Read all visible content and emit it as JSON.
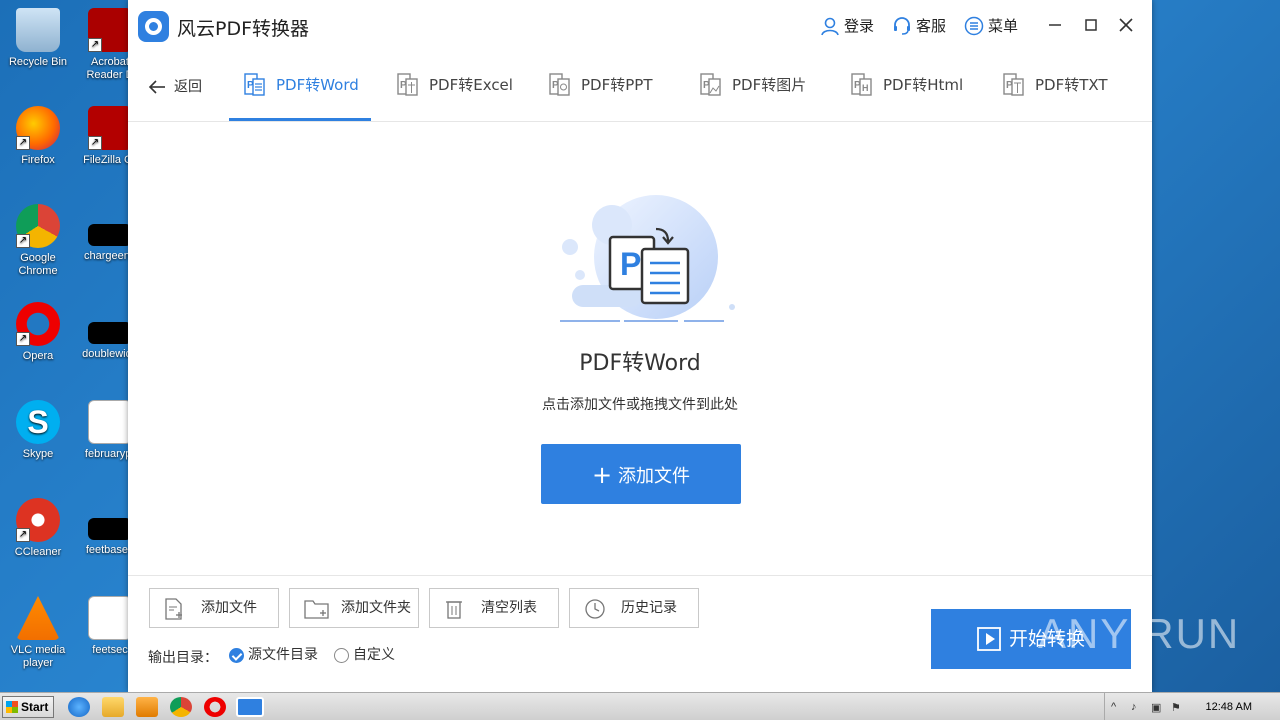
{
  "desktop": {
    "icons": [
      {
        "label": "Recycle Bin"
      },
      {
        "label": "Acrobat Reader D"
      },
      {
        "label": "Firefox"
      },
      {
        "label": "FileZilla Cli"
      },
      {
        "label": "Google Chrome"
      },
      {
        "label": "chargeeng"
      },
      {
        "label": "Opera"
      },
      {
        "label": "doublewide"
      },
      {
        "label": "Skype"
      },
      {
        "label": "februarypr"
      },
      {
        "label": "CCleaner"
      },
      {
        "label": "feetbased"
      },
      {
        "label": "VLC media player"
      },
      {
        "label": "feetsec"
      }
    ]
  },
  "app": {
    "title": "风云PDF转换器",
    "header": {
      "login_label": "登录",
      "support_label": "客服",
      "menu_label": "菜单"
    },
    "nav": {
      "back_label": "返回",
      "tabs": [
        {
          "label": "PDF转Word",
          "active": true
        },
        {
          "label": "PDF转Excel"
        },
        {
          "label": "PDF转PPT"
        },
        {
          "label": "PDF转图片"
        },
        {
          "label": "PDF转Html"
        },
        {
          "label": "PDF转TXT"
        }
      ]
    },
    "main": {
      "title": "PDF转Word",
      "subtitle": "点击添加文件或拖拽文件到此处",
      "add_file_label": "添加文件",
      "illustration_letter": "P"
    },
    "bottom": {
      "tools": [
        {
          "label": "添加文件"
        },
        {
          "label": "添加文件夹"
        },
        {
          "label": "清空列表"
        },
        {
          "label": "历史记录"
        }
      ],
      "output_label": "输出目录：",
      "options": [
        {
          "label": "源文件目录",
          "checked": true
        },
        {
          "label": "自定义",
          "checked": false
        }
      ],
      "start_label": "开始转换"
    }
  },
  "taskbar": {
    "start_label": "Start",
    "clock": "12:48 AM"
  },
  "watermark": "ANY RUN",
  "colors": {
    "accent": "#2f80e0",
    "desktop": "#1c6fb8"
  }
}
